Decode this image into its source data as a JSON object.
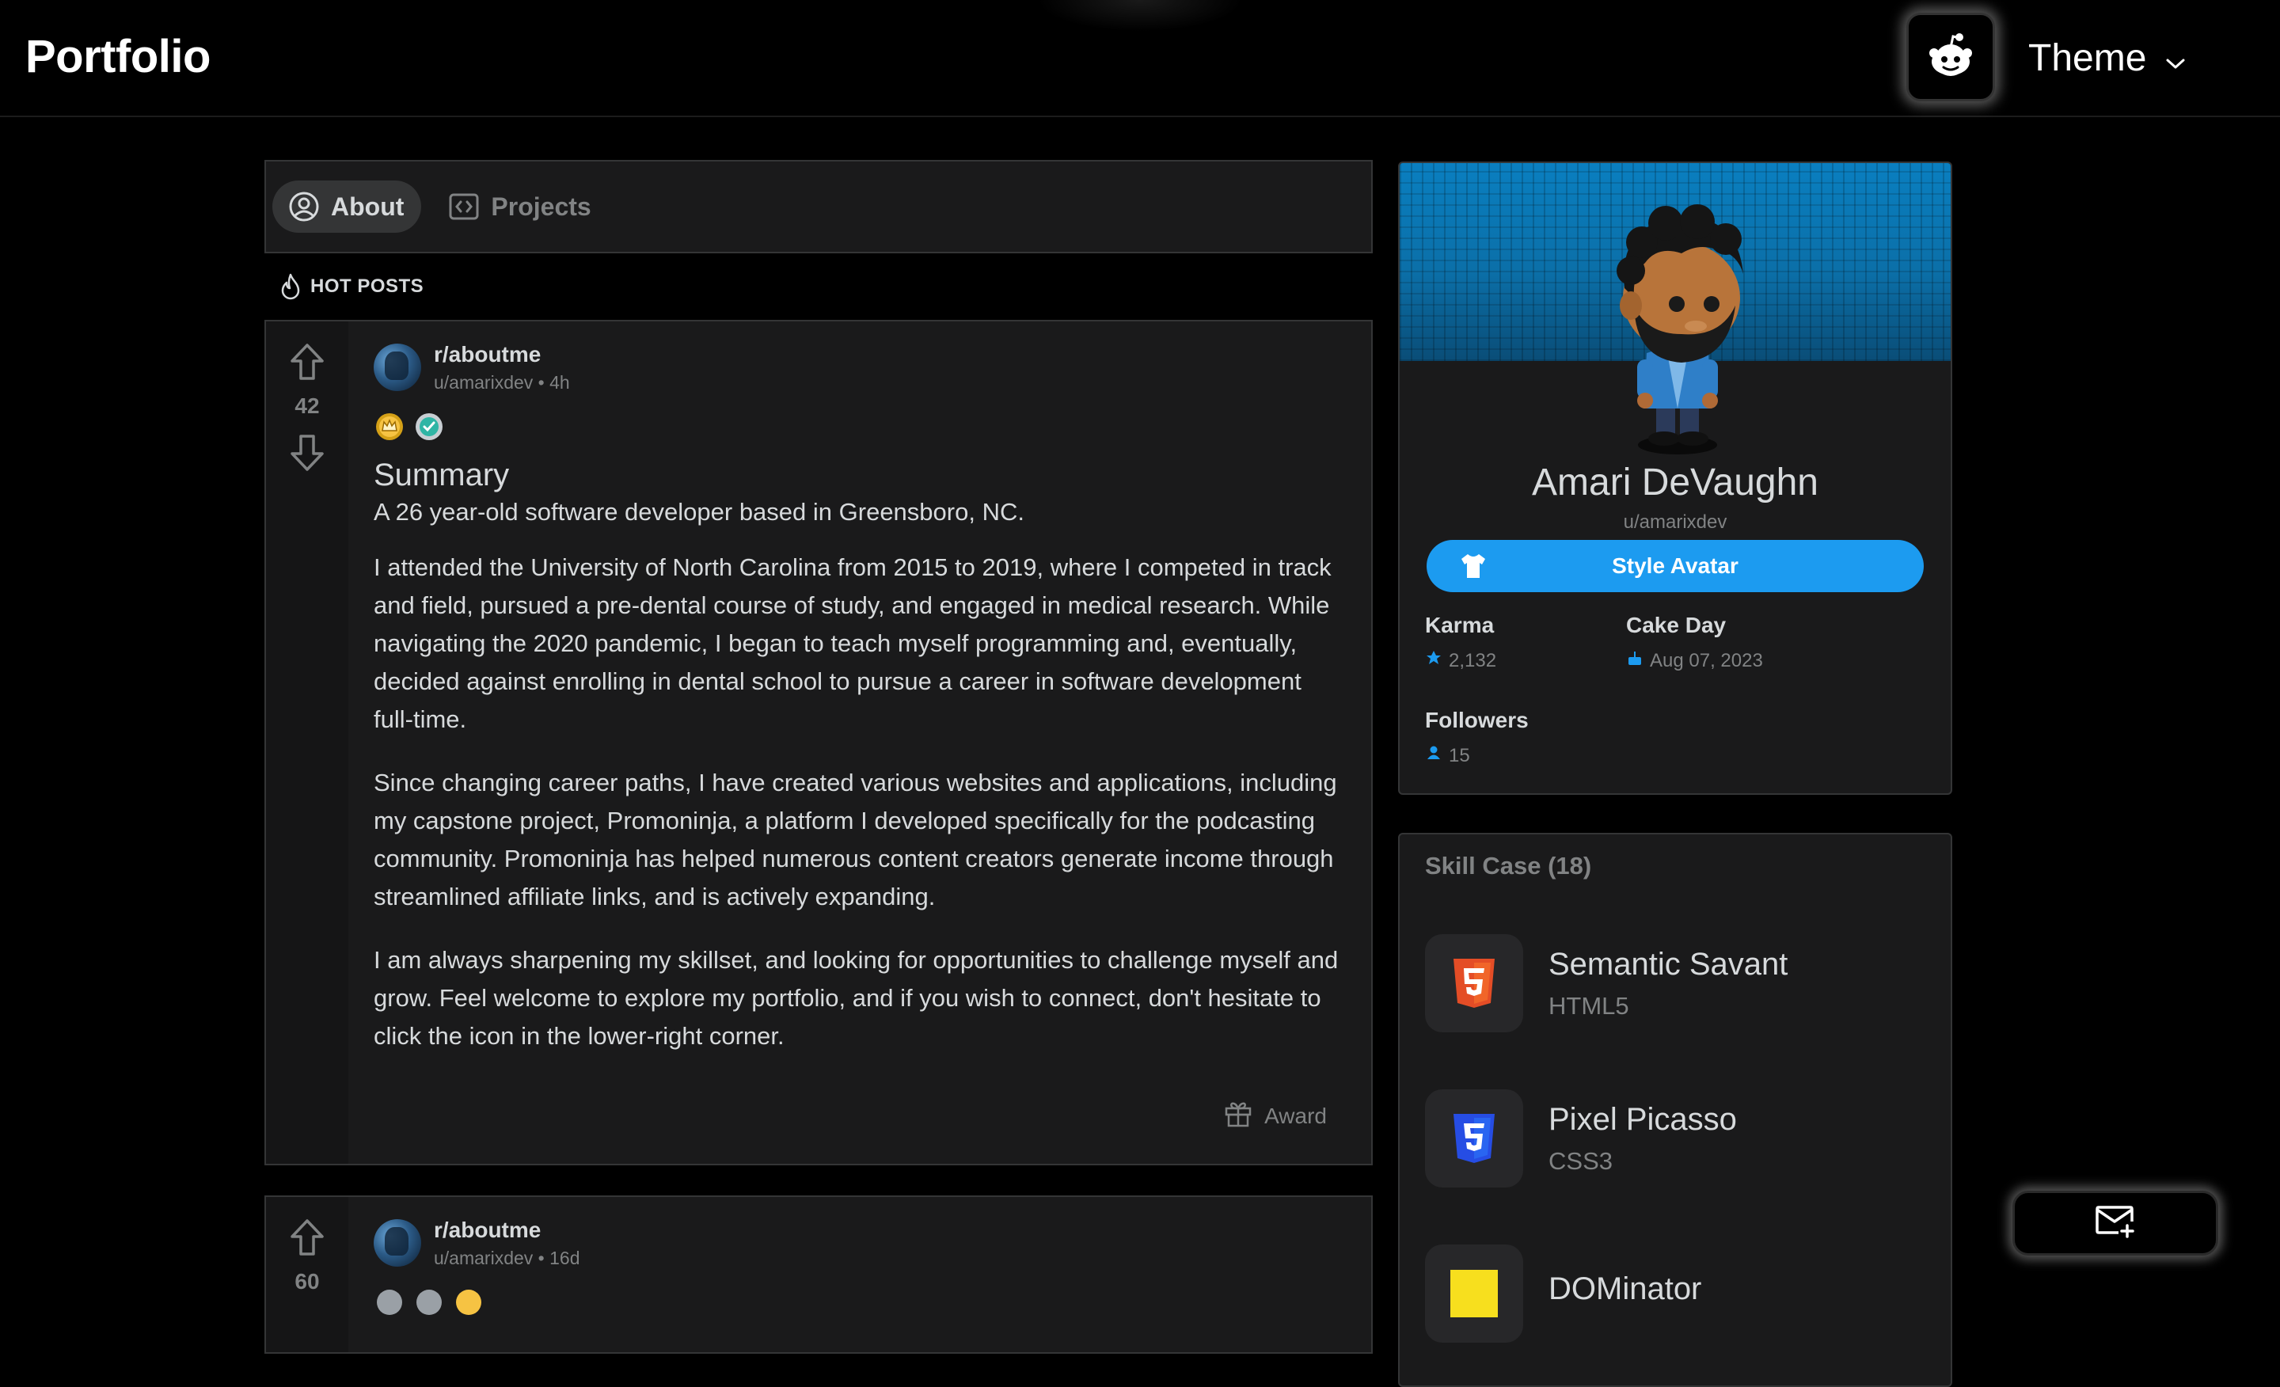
{
  "app": {
    "logo": "Portfolio",
    "theme_label": "Theme"
  },
  "tabs": [
    {
      "label": "About",
      "active": true,
      "icon": "user-circle-icon"
    },
    {
      "label": "Projects",
      "active": false,
      "icon": "code-icon"
    }
  ],
  "hot_posts_label": "HOT POSTS",
  "posts": [
    {
      "subreddit": "r/aboutme",
      "user": "u/amarixdev",
      "age": "4h",
      "byline": "u/amarixdev • 4h",
      "votes": "42",
      "awards": [
        "gold-crown-award-icon",
        "helpful-award-icon"
      ],
      "title": "Summary",
      "paragraphs": [
        "A 26 year-old software developer based in Greensboro, NC.",
        "I attended the University of North Carolina from 2015 to 2019, where I competed in track and field, pursued a pre-dental course of study, and engaged in medical research. While navigating the 2020 pandemic, I began to teach myself programming and, eventually, decided against enrolling in dental school to pursue a career in software development full-time.",
        "Since changing career paths, I have created various websites and applications, including my capstone project, Promoninja, a platform I developed specifically for the podcasting community. Promoninja has helped numerous content creators generate income through streamlined affiliate links, and is actively expanding.",
        "I am always sharpening my skillset, and looking for opportunities to challenge myself and grow. Feel welcome to explore my portfolio, and if you wish to connect, don't hesitate to click the icon in the lower-right corner."
      ],
      "award_label": "Award"
    },
    {
      "subreddit": "r/aboutme",
      "user": "u/amarixdev",
      "age": "16d",
      "byline": "u/amarixdev • 16d",
      "votes": "60"
    }
  ],
  "profile": {
    "name": "Amari DeVaughn",
    "username": "u/amarixdev",
    "style_avatar_label": "Style Avatar",
    "karma_label": "Karma",
    "karma_value": "2,132",
    "cake_day_label": "Cake Day",
    "cake_day_value": "Aug 07, 2023",
    "followers_label": "Followers",
    "followers_value": "15",
    "banner_color": "#0a7fc0",
    "button_color": "#1c9bf0"
  },
  "skills": {
    "title": "Skill Case (18)",
    "items": [
      {
        "name": "Semantic Savant",
        "tech": "HTML5",
        "icon": "html5-icon",
        "color": "#e44d26"
      },
      {
        "name": "Pixel Picasso",
        "tech": "CSS3",
        "icon": "css3-icon",
        "color": "#264de4"
      },
      {
        "name": "DOMinator",
        "tech": "",
        "icon": "javascript-icon",
        "color": "#f7df1e"
      }
    ]
  },
  "colors": {
    "background": "#000000",
    "card": "#1a1a1b",
    "border": "#343536",
    "text": "#d7dadc",
    "muted": "#818384"
  }
}
